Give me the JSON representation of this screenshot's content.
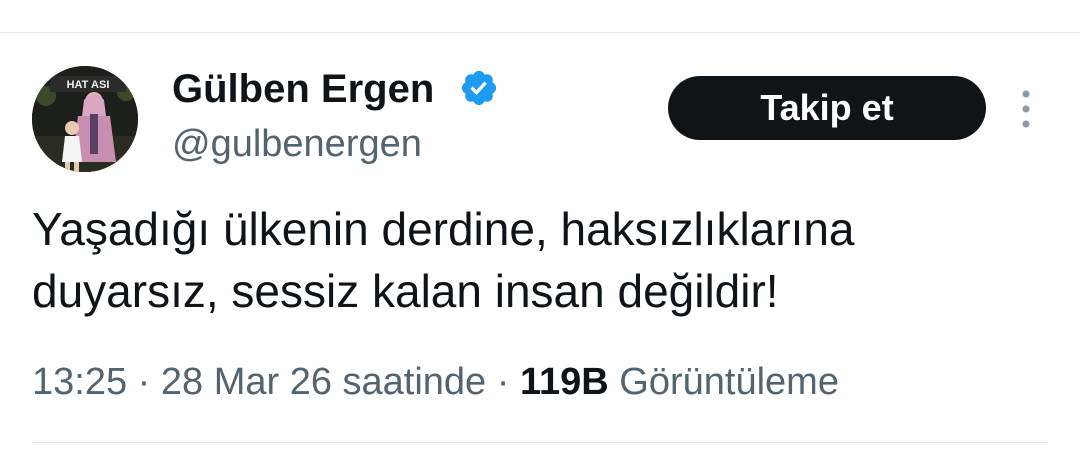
{
  "tweet": {
    "author": {
      "display_name": "Gülben Ergen",
      "handle": "@gulbenergen",
      "verified": true,
      "avatar_sign_text": "HAT ASI"
    },
    "follow_label": "Takip et",
    "text": "Yaşadığı ülkenin derdine, haksızlıklarına duyarsız, sessiz kalan insan değildir!",
    "time": "13:25",
    "separator": "·",
    "date_text": "28 Mar 26 saatinde",
    "views_count": "119B",
    "views_label": "Görüntüleme"
  },
  "icons": {
    "verified": "verified-badge-icon",
    "more": "more-vertical-icon"
  },
  "colors": {
    "verified_blue": "#1d9bf0",
    "button_bg": "#0f1419",
    "secondary_text": "#536471"
  }
}
